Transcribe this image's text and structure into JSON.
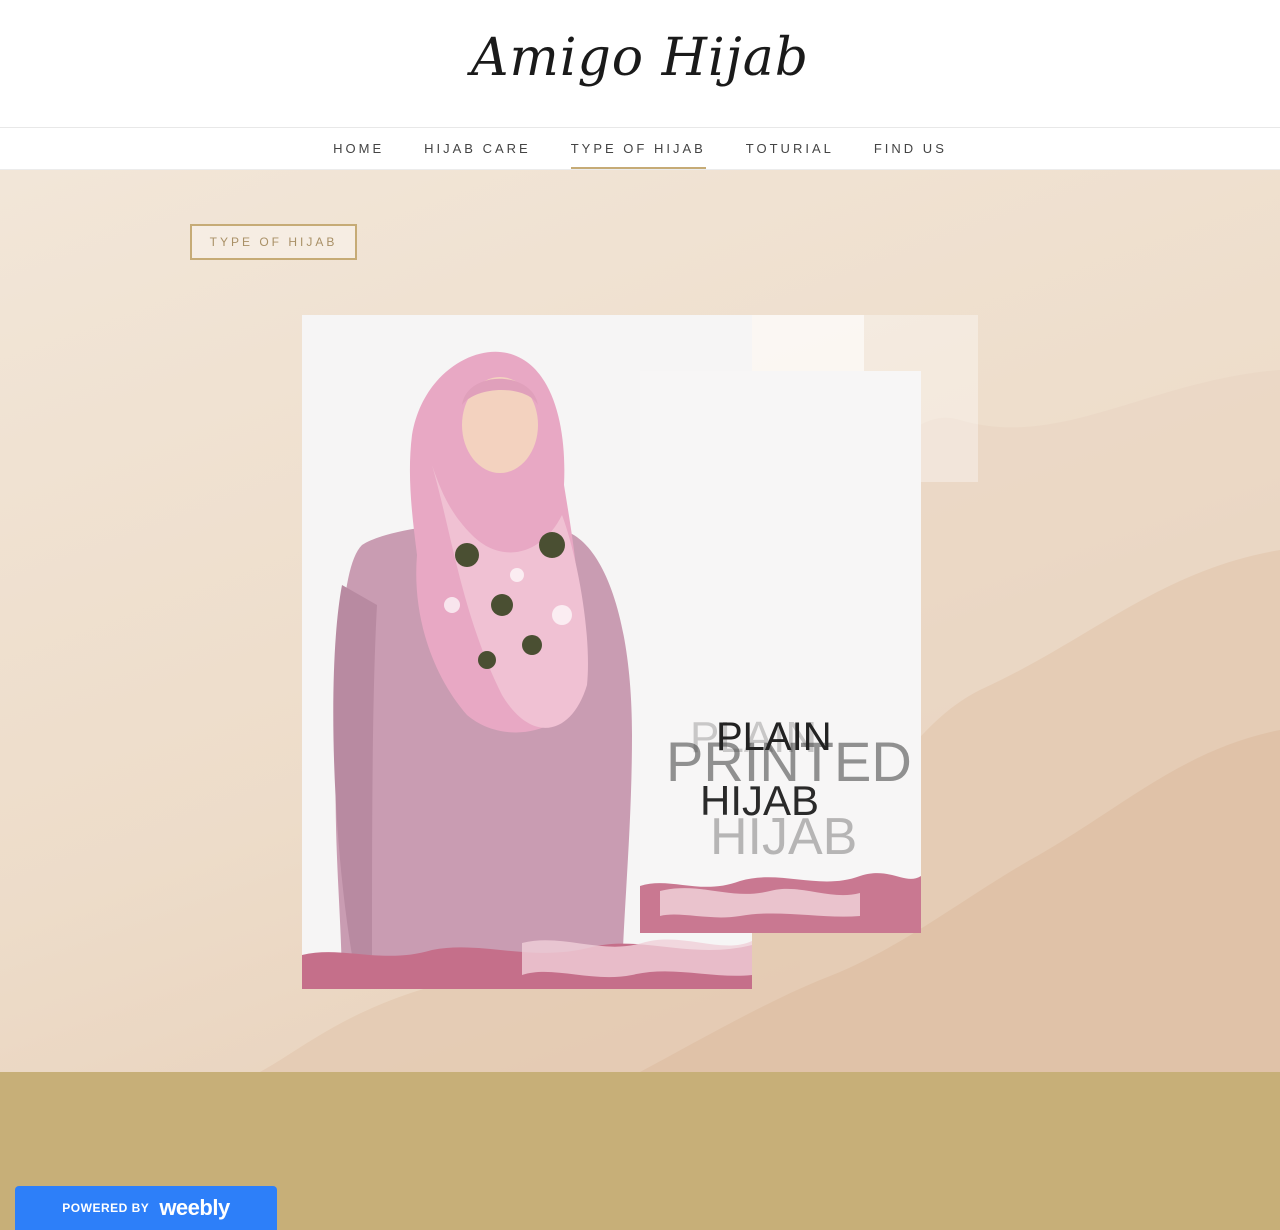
{
  "site": {
    "logo": "Amigo Hijab"
  },
  "nav": {
    "items": [
      {
        "label": "HOME"
      },
      {
        "label": "HIJAB CARE"
      },
      {
        "label": "TYPE OF HIJAB"
      },
      {
        "label": "TOTURIAL"
      },
      {
        "label": "FIND US"
      }
    ],
    "active_index": 2
  },
  "hero": {
    "tag_label": "TYPE OF HIJAB",
    "overlay_text": {
      "line1_a": "PLAIN",
      "line1_b": "PRINTED",
      "line2_a": "HIJAB",
      "line2_b": "HIJAB"
    }
  },
  "badge": {
    "powered_by": "POWERED BY",
    "brand": "weebly"
  },
  "colors": {
    "accent": "#c6ab76",
    "footer_band": "#c7af78",
    "badge_blue": "#2d7ff9"
  }
}
